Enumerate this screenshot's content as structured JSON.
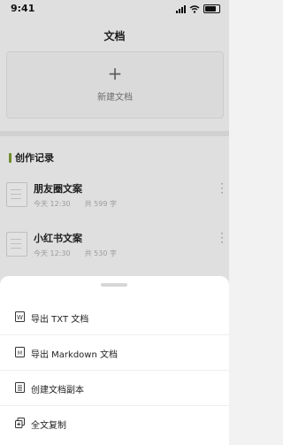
{
  "status": {
    "time": "9:41"
  },
  "header": {
    "title": "文档"
  },
  "new_doc": {
    "plus": "+",
    "label": "新建文档"
  },
  "section": {
    "title": "创作记录"
  },
  "documents": [
    {
      "name": "朋友圈文案",
      "time": "今天 12:30",
      "count": "共 599 字"
    },
    {
      "name": "小红书文案",
      "time": "今天 12:30",
      "count": "共 530 字"
    }
  ],
  "sheet": {
    "items": [
      {
        "label": "导出 TXT 文档",
        "icon": "txt-file-icon"
      },
      {
        "label": "导出 Markdown 文档",
        "icon": "markdown-file-icon"
      },
      {
        "label": "创建文档副本",
        "icon": "copy-doc-icon"
      },
      {
        "label": "全文复制",
        "icon": "duplicate-icon"
      }
    ]
  }
}
